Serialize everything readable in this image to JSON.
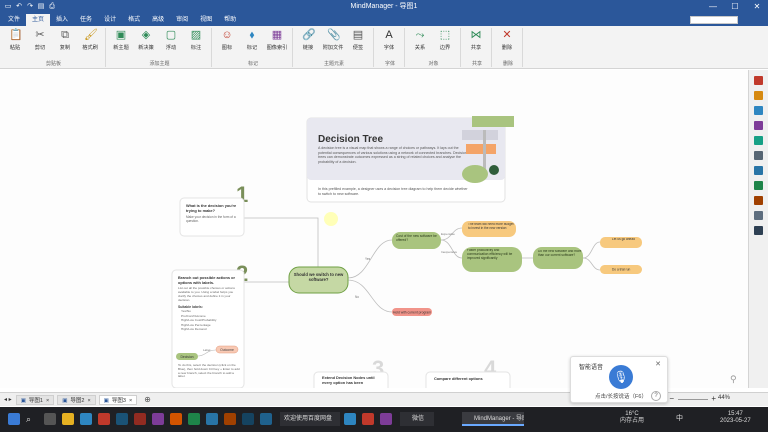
{
  "titlebar": {
    "title": "MindManager - 导图1",
    "qat_icons": [
      "save-icon",
      "undo-icon",
      "redo-icon",
      "open-icon",
      "print-icon"
    ],
    "win_controls": [
      "—",
      "☐",
      "✕"
    ]
  },
  "tabs": [
    "文件",
    "主页",
    "插入",
    "任务",
    "设计",
    "格式",
    "高级",
    "审阅",
    "视图",
    "帮助"
  ],
  "active_tab_index": 1,
  "ribbon": {
    "groups": [
      {
        "label": "剪贴板",
        "buttons": [
          {
            "label": "粘贴",
            "icon": "paste-icon"
          },
          {
            "label": "剪切",
            "icon": "cut-icon"
          },
          {
            "label": "复制",
            "icon": "copy-icon"
          },
          {
            "label": "格式刷",
            "icon": "format-brush-icon"
          }
        ]
      },
      {
        "label": "添加主题",
        "buttons": [
          {
            "label": "新主题",
            "icon": "new-topic-icon"
          },
          {
            "label": "新决策",
            "icon": "new-decision-icon"
          },
          {
            "label": "浮动",
            "icon": "floating-icon"
          },
          {
            "label": "标注",
            "icon": "callout-icon"
          }
        ]
      },
      {
        "label": "标记",
        "buttons": [
          {
            "label": "图标",
            "icon": "icon-icon"
          },
          {
            "label": "标记",
            "icon": "tag-icon"
          },
          {
            "label": "图像索引",
            "icon": "image-index-icon"
          }
        ]
      },
      {
        "label": "主题元素",
        "buttons": [
          {
            "label": "链接",
            "icon": "link-icon"
          },
          {
            "label": "附加文件",
            "icon": "attach-icon"
          },
          {
            "label": "便签",
            "icon": "note-icon"
          }
        ]
      },
      {
        "label": "字体",
        "buttons": [
          {
            "label": "字体",
            "icon": "font-icon"
          }
        ]
      },
      {
        "label": "对象",
        "buttons": [
          {
            "label": "关系",
            "icon": "relationship-icon"
          },
          {
            "label": "边界",
            "icon": "boundary-icon"
          }
        ]
      },
      {
        "label": "共享",
        "buttons": [
          {
            "label": "共享",
            "icon": "share-icon"
          }
        ]
      },
      {
        "label": "删除",
        "buttons": [
          {
            "label": "删除",
            "icon": "delete-icon"
          }
        ]
      }
    ]
  },
  "map": {
    "header": {
      "title": "Decision Tree",
      "body": "A decision tree is a visual map that shows a range of choices or pathways. It lays out the potential consequences of various solutions using a network of connected branches. Decision trees can demonstrate outcomes expressed as a string of related choices and analyse the probability of a decision.",
      "footer": "In this prefilled example, a designer uses a decision tree diagram to help them decide whether to switch to new software."
    },
    "steps": [
      {
        "num": "1",
        "title": "What is the decision you're trying to make?",
        "body": "Make your decision in the form of a question."
      },
      {
        "num": "2",
        "title": "Branch out possible actions or options with labels.",
        "body": "List out all the possible choices or actions available to you. Using a label helps you clarify the choices and define it in your decision.",
        "subtitle": "Suitable labels:",
        "labels": [
          "Yes/No",
          "Pro/Con/Outcome",
          "High/Low Cost/Probability",
          "High/Low Percentage",
          "High/Low Demand"
        ],
        "decision_label": "Decision",
        "label_label": "Label",
        "outcome_label": "Outcome",
        "footer": "To do this, select the decision (click on the Blue), then hold down Ctrl key + Enter to add a new branch, select the branch to add a label."
      },
      {
        "num": "3",
        "title": "Extend Decision Nodes until every option has been"
      },
      {
        "num": "4",
        "title": "Compare different options"
      }
    ],
    "root": "Should we switch to new software?",
    "yes_label": "Yes",
    "no_label": "No",
    "branch_yes": "Cost of the new software be offered?",
    "branch_no": "Hold with current program",
    "sub_expensive_label": "Expensive",
    "sub_inexpensive_label": "Inexpensive",
    "sub_expensive": "The team will need more budget to invest in the new version",
    "sub_inexpensive": "Faster productivity and communication efficiency will be improved significantly",
    "next_q": "Do the new software and more than our current software?",
    "next_yes": "Let us go ahead",
    "next_no": "Do a trial run"
  },
  "doctabs": {
    "tabs": [
      "导图1",
      "导图2",
      "导图3"
    ],
    "active_index": 2,
    "zoom": "44%"
  },
  "voice": {
    "title": "智能语音",
    "status": "点击/长按说话（F6）",
    "help": "?"
  },
  "taskbar": {
    "app1": "欢迎使用百度网盘",
    "app2": "微信",
    "app3": "MindManager - 导图1",
    "weather": "16°C",
    "weather2": "内存占用",
    "time": "15:47",
    "date": "2023-05-27",
    "lang": "中"
  },
  "colors": {
    "ribbon_blue": "#2b579a",
    "root_green": "#c5d8a4",
    "node_green": "#a9c47f",
    "node_orange": "#f7c97e",
    "node_red": "#f1948a",
    "header_bg": "#e8e8f0"
  }
}
